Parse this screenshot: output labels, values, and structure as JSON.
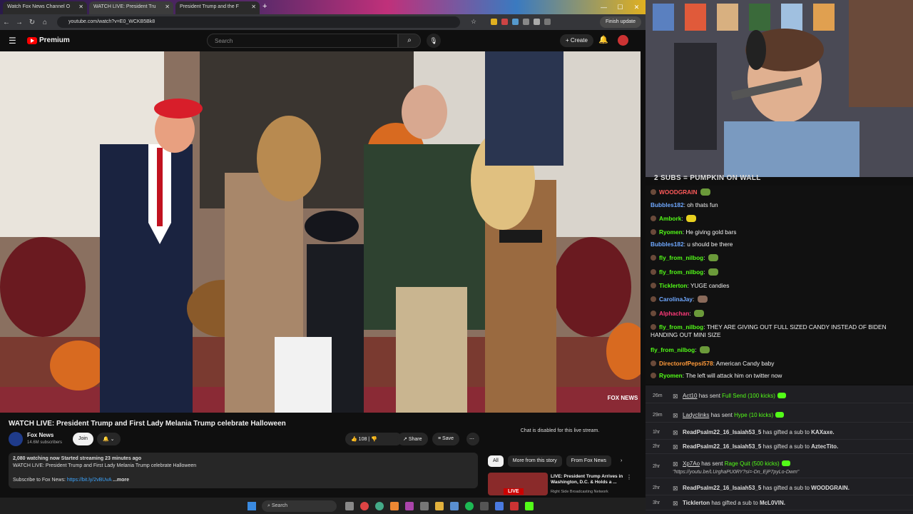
{
  "browser": {
    "tabs": [
      {
        "title": "Watch Fox News Channel O"
      },
      {
        "title": "WATCH LIVE: President Tru"
      },
      {
        "title": "President Trump and the F"
      }
    ],
    "url": "youtube.com/watch?v=E0_WCKB5Bk8",
    "finish_update": "Finish update"
  },
  "youtube": {
    "brand": "Premium",
    "search_placeholder": "Search",
    "create_label": "Create",
    "video_title": "WATCH LIVE: President Trump and First Lady Melania Trump celebrate Halloween",
    "channel_name": "Fox News",
    "subscribers": "14.6M subscribers",
    "join_label": "Join",
    "like_count": "108",
    "share_label": "Share",
    "save_label": "Save",
    "watermark": "FOX NEWS",
    "description": {
      "stats": "2,080 watching now  Started streaming 23 minutes ago",
      "line1": "WATCH LIVE: President Trump and First Lady Melania Trump celebrate Halloween",
      "subscribe_text": "Subscribe to Fox News: ",
      "subscribe_link": "https://bit.ly/2vBUvA",
      "more": "...more"
    },
    "chat_disabled": "Chat is disabled for this live stream.",
    "chips": [
      "All",
      "More from this story",
      "From Fox News"
    ],
    "suggestion": {
      "title": "LIVE: President Trump Arrives in Washington, D.C. & Holds a ...",
      "channel": "Right Side Broadcasting Network",
      "badge": "LIVE"
    }
  },
  "taskbar": {
    "search": "Search"
  },
  "stream": {
    "overlay": "2 SUBS = PUMPKIN ON WALL",
    "chat": [
      {
        "user": "WOODGRAIN",
        "color": "#ff5a5a",
        "text": ""
      },
      {
        "user": "Bubbles182",
        "color": "#6fa8ff",
        "text": "oh thats fun"
      },
      {
        "user": "Ambork",
        "color": "#53fc18",
        "text": ""
      },
      {
        "user": "Ryomen",
        "color": "#53fc18",
        "text": "He giving gold bars"
      },
      {
        "user": "Bubbles182",
        "color": "#6fa8ff",
        "text": "u should be there"
      },
      {
        "user": "fly_from_nilbog",
        "color": "#53fc18",
        "text": ""
      },
      {
        "user": "fly_from_nilbog",
        "color": "#53fc18",
        "text": ""
      },
      {
        "user": "Ticklerton",
        "color": "#53fc18",
        "text": "YUGE candies"
      },
      {
        "user": "CarolinaJay",
        "color": "#6fa8ff",
        "text": ""
      },
      {
        "user": "Alphachan",
        "color": "#ff3a7a",
        "text": ""
      },
      {
        "user": "fly_from_nilbog",
        "color": "#53fc18",
        "text": "THEY ARE GIVING OUT FULL SIZED CANDY INSTEAD OF BIDEN HANDING OUT MINI SIZE"
      },
      {
        "user": "fly_from_nilbog",
        "color": "#53fc18",
        "text": ""
      },
      {
        "user": "DirectorofPepsi578",
        "color": "#ff9a3a",
        "text": "American Candy baby"
      },
      {
        "user": "Ryomen",
        "color": "#53fc18",
        "text": "The left will attack him on twitter now"
      }
    ],
    "events": [
      {
        "time": "26m",
        "user": "Act10",
        "action": "has sent ",
        "item": "Full Send (100 kicks)"
      },
      {
        "time": "29m",
        "user": "Ladyclinks",
        "action": "has sent ",
        "item": "Hype (10 kicks)"
      },
      {
        "time": "1hr",
        "user": "ReadPsalm22_16_Isaiah53_5",
        "action": "has gifted a sub to ",
        "item": "KAXaxe."
      },
      {
        "time": "2hr",
        "user": "ReadPsalm22_16_Isaiah53_5",
        "action": "has gifted a sub to ",
        "item": "AztecTito."
      },
      {
        "time": "2hr",
        "user": "Xp7Ao",
        "action": "has sent ",
        "item": "Rage Quit (500 kicks)",
        "note": "\"https://youtu.be/LUrghaPU0RY?si=-Dn_EjP7pyLo-Dwm\""
      },
      {
        "time": "2hr",
        "user": "ReadPsalm22_16_Isaiah53_5",
        "action": "has gifted a sub to ",
        "item": "WOODGRAIN."
      },
      {
        "time": "3hr",
        "user": "Ticklerton",
        "action": "has gifted a sub to ",
        "item": "McL0VIN."
      }
    ]
  }
}
